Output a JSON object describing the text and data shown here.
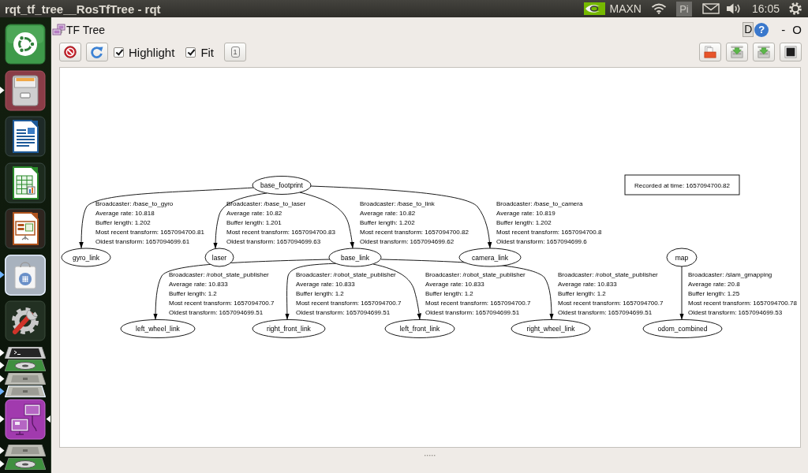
{
  "top_bar": {
    "title": "rqt_tf_tree__RosTfTree - rqt",
    "power_mode": "MAXN",
    "input_source": "Pi",
    "time": "16:05"
  },
  "launcher": {
    "items": [
      {
        "kind": "dash",
        "folded": false,
        "running": false,
        "selected": false,
        "focused": false
      },
      {
        "kind": "files",
        "folded": false,
        "running": true,
        "selected": false,
        "focused": false
      },
      {
        "kind": "writer",
        "folded": false,
        "running": false,
        "selected": false,
        "focused": false
      },
      {
        "kind": "calc",
        "folded": false,
        "running": false,
        "selected": false,
        "focused": false
      },
      {
        "kind": "impress",
        "folded": false,
        "running": false,
        "selected": false,
        "focused": false
      },
      {
        "kind": "software",
        "folded": false,
        "running": true,
        "selected": true,
        "focused": false
      },
      {
        "kind": "settings",
        "folded": false,
        "running": false,
        "selected": false,
        "focused": false
      },
      {
        "kind": "terminal",
        "folded": true,
        "running": true,
        "selected": false,
        "focused": false
      },
      {
        "kind": "disc",
        "folded": true,
        "running": true,
        "selected": false,
        "focused": false
      },
      {
        "kind": "drive",
        "folded": true,
        "running": true,
        "selected": false,
        "focused": false
      },
      {
        "kind": "drive",
        "folded": true,
        "running": true,
        "selected": true,
        "focused": false
      },
      {
        "kind": "rqt",
        "folded": false,
        "running": true,
        "selected": false,
        "focused": true
      },
      {
        "kind": "drive",
        "folded": true,
        "running": true,
        "selected": false,
        "focused": false
      },
      {
        "kind": "disc",
        "folded": true,
        "running": true,
        "selected": false,
        "focused": false
      }
    ]
  },
  "plugin": {
    "title": "TF Tree",
    "dock_button": "D",
    "help_button": "?",
    "minimize_button": "-",
    "close_button": "O"
  },
  "toolbar": {
    "left": [
      {
        "kind": "stop"
      },
      {
        "kind": "refresh"
      },
      {
        "kind": "checkbox",
        "label": "Highlight",
        "checked": true
      },
      {
        "kind": "checkbox",
        "label": "Fit",
        "checked": true
      },
      {
        "kind": "one_to_one",
        "label": "1"
      }
    ],
    "right": [
      {
        "kind": "folder"
      },
      {
        "kind": "tray"
      },
      {
        "kind": "tray"
      },
      {
        "kind": "frame"
      }
    ]
  },
  "graph": {
    "timestamp": "Recorded at time: 1657094700.82",
    "roots": [
      {
        "name": "base_footprint",
        "children": [
          {
            "name": "gyro_link",
            "edge": {
              "broadcaster": "Broadcaster: /base_to_gyro",
              "average_rate": "Average rate: 10.818",
              "buffer_length": "Buffer length: 1.202",
              "most_recent_transform": "Most recent transform: 1657094700.81",
              "oldest_transform": "Oldest transform: 1657094699.61"
            }
          },
          {
            "name": "laser",
            "edge": {
              "broadcaster": "Broadcaster: /base_to_laser",
              "average_rate": "Average rate: 10.82",
              "buffer_length": "Buffer length: 1.201",
              "most_recent_transform": "Most recent transform: 1657094700.83",
              "oldest_transform": "Oldest transform: 1657094699.63"
            }
          },
          {
            "name": "base_link",
            "edge": {
              "broadcaster": "Broadcaster: /base_to_link",
              "average_rate": "Average rate: 10.82",
              "buffer_length": "Buffer length: 1.202",
              "most_recent_transform": "Most recent transform: 1657094700.82",
              "oldest_transform": "Oldest transform: 1657094699.62"
            },
            "children": [
              {
                "name": "left_wheel_link",
                "edge": {
                  "broadcaster": "Broadcaster: /robot_state_publisher",
                  "average_rate": "Average rate: 10.833",
                  "buffer_length": "Buffer length: 1.2",
                  "most_recent_transform": "Most recent transform: 1657094700.7",
                  "oldest_transform": "Oldest transform: 1657094699.51"
                }
              },
              {
                "name": "right_front_link",
                "edge": {
                  "broadcaster": "Broadcaster: /robot_state_publisher",
                  "average_rate": "Average rate: 10.833",
                  "buffer_length": "Buffer length: 1.2",
                  "most_recent_transform": "Most recent transform: 1657094700.7",
                  "oldest_transform": "Oldest transform: 1657094699.51"
                }
              },
              {
                "name": "left_front_link",
                "edge": {
                  "broadcaster": "Broadcaster: /robot_state_publisher",
                  "average_rate": "Average rate: 10.833",
                  "buffer_length": "Buffer length: 1.2",
                  "most_recent_transform": "Most recent transform: 1657094700.7",
                  "oldest_transform": "Oldest transform: 1657094699.51"
                }
              },
              {
                "name": "right_wheel_link",
                "edge": {
                  "broadcaster": "Broadcaster: /robot_state_publisher",
                  "average_rate": "Average rate: 10.833",
                  "buffer_length": "Buffer length: 1.2",
                  "most_recent_transform": "Most recent transform: 1657094700.7",
                  "oldest_transform": "Oldest transform: 1657094699.51"
                }
              }
            ]
          },
          {
            "name": "camera_link",
            "edge": {
              "broadcaster": "Broadcaster: /base_to_camera",
              "average_rate": "Average rate: 10.819",
              "buffer_length": "Buffer length: 1.202",
              "most_recent_transform": "Most recent transform: 1657094700.8",
              "oldest_transform": "Oldest transform: 1657094699.6"
            }
          }
        ]
      },
      {
        "name": "map",
        "children": [
          {
            "name": "odom_combined",
            "edge": {
              "broadcaster": "Broadcaster: /slam_gmapping",
              "average_rate": "Average rate: 20.8",
              "buffer_length": "Buffer length: 1.25",
              "most_recent_transform": "Most recent transform: 1657094700.78",
              "oldest_transform": "Oldest transform: 1657094699.53"
            }
          }
        ]
      }
    ]
  }
}
